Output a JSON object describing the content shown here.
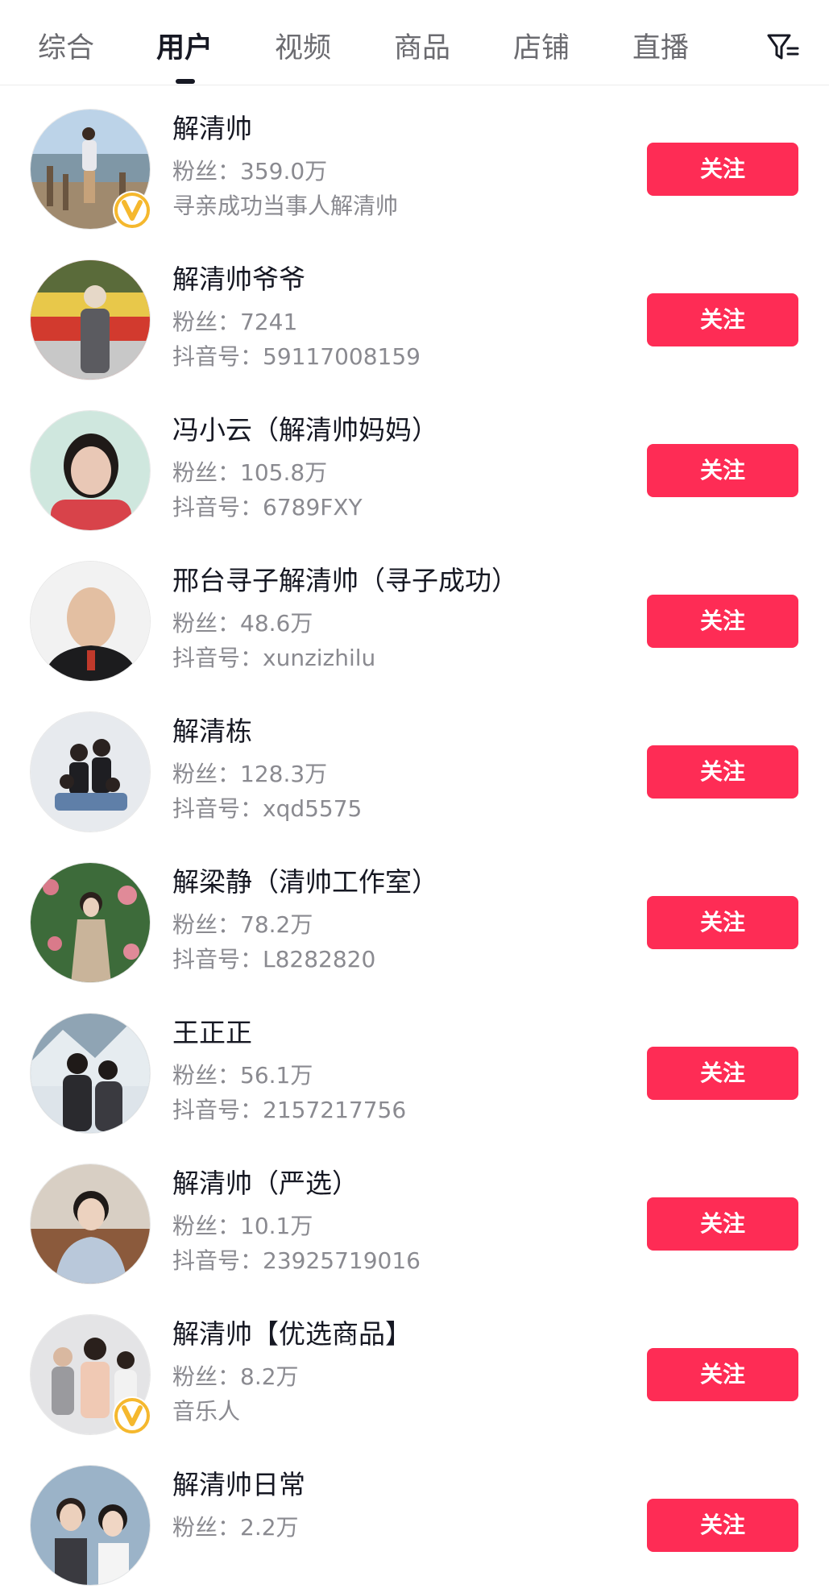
{
  "tabs": [
    {
      "label": "综合",
      "active": false
    },
    {
      "label": "用户",
      "active": true
    },
    {
      "label": "视频",
      "active": false
    },
    {
      "label": "商品",
      "active": false
    },
    {
      "label": "店铺",
      "active": false
    },
    {
      "label": "直播",
      "active": false
    }
  ],
  "filter_icon": "filter-icon",
  "colors": {
    "follow_button": "#fe2c55",
    "verified_badge": "#f5b82e",
    "text_primary": "#161823",
    "text_secondary": "#8a8a90"
  },
  "users": [
    {
      "name": "解清帅",
      "fans_label": "粉丝：",
      "fans": "359.0万",
      "sub": "寻亲成功当事人解清帅",
      "verified": true,
      "follow_label": "关注"
    },
    {
      "name": "解清帅爷爷",
      "fans_label": "粉丝：",
      "fans": "7241",
      "sub": "抖音号：59117008159",
      "verified": false,
      "follow_label": "关注"
    },
    {
      "name": "冯小云（解清帅妈妈）",
      "fans_label": "粉丝：",
      "fans": "105.8万",
      "sub": "抖音号：6789FXY",
      "verified": false,
      "follow_label": "关注"
    },
    {
      "name": "邢台寻子解清帅（寻子成功）",
      "fans_label": "粉丝：",
      "fans": "48.6万",
      "sub": "抖音号：xunzizhilu",
      "verified": false,
      "follow_label": "关注"
    },
    {
      "name": "解清栋",
      "fans_label": "粉丝：",
      "fans": "128.3万",
      "sub": "抖音号：xqd5575",
      "verified": false,
      "follow_label": "关注"
    },
    {
      "name": "解梁静（清帅工作室）",
      "fans_label": "粉丝：",
      "fans": "78.2万",
      "sub": "抖音号：L8282820",
      "verified": false,
      "follow_label": "关注"
    },
    {
      "name": "王正正",
      "fans_label": "粉丝：",
      "fans": "56.1万",
      "sub": "抖音号：2157217756",
      "verified": false,
      "follow_label": "关注"
    },
    {
      "name": "解清帅（严选）",
      "fans_label": "粉丝：",
      "fans": "10.1万",
      "sub": "抖音号：23925719016",
      "verified": false,
      "follow_label": "关注"
    },
    {
      "name": "解清帅【优选商品】",
      "fans_label": "粉丝：",
      "fans": "8.2万",
      "sub": "音乐人",
      "verified": true,
      "follow_label": "关注"
    },
    {
      "name": "解清帅日常",
      "fans_label": "粉丝：",
      "fans": "2.2万",
      "sub": "",
      "verified": false,
      "follow_label": "关注"
    }
  ]
}
